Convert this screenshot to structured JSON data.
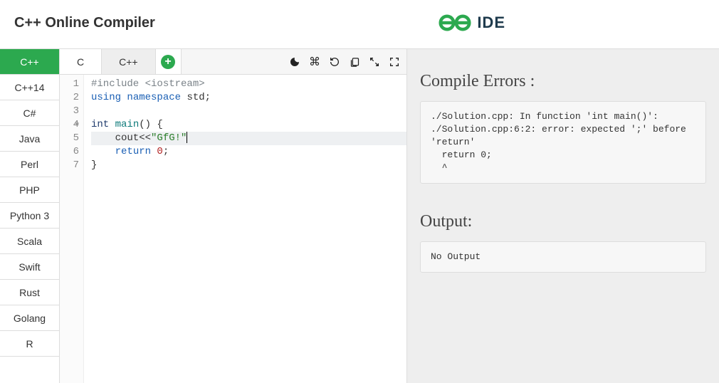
{
  "header": {
    "title": "C++ Online Compiler",
    "logo_text": "IDE"
  },
  "tabs": {
    "t0": "C",
    "t1": "C++",
    "plus": "+"
  },
  "languages": [
    "C++",
    "C++14",
    "C#",
    "Java",
    "Perl",
    "PHP",
    "Python 3",
    "Scala",
    "Swift",
    "Rust",
    "Golang",
    "R"
  ],
  "active_language_index": 0,
  "gutter": {
    "l1": "1",
    "l2": "2",
    "l3": "3",
    "l4": "4",
    "l5": "5",
    "l6": "6",
    "l7": "7"
  },
  "code": {
    "l1_a": "#include ",
    "l1_b": "<iostream>",
    "l2_a": "using ",
    "l2_b": "namespace ",
    "l2_c": "std;",
    "l3": "",
    "l4_a": "int ",
    "l4_b": "main",
    "l4_c": "() {",
    "l5_a": "    cout<<",
    "l5_b": "\"GfG!\"",
    "l6_a": "    ",
    "l6_b": "return ",
    "l6_c": "0",
    "l6_d": ";",
    "l7": "}"
  },
  "errors": {
    "title": "Compile Errors :",
    "text": "./Solution.cpp: In function 'int main()':\n./Solution.cpp:6:2: error: expected ';' before 'return'\n  return 0;\n  ^"
  },
  "output": {
    "title": "Output:",
    "text": "No Output"
  }
}
